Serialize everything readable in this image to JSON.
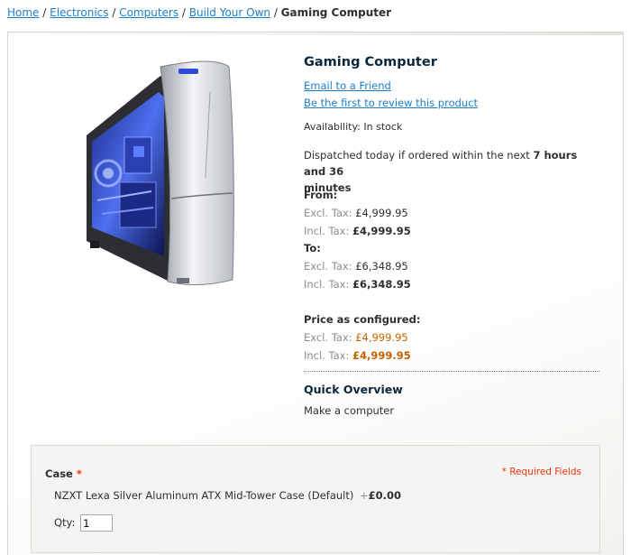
{
  "breadcrumb": {
    "items": [
      "Home",
      "Electronics",
      "Computers",
      "Build Your Own"
    ],
    "separator": " / ",
    "current": "Gaming Computer"
  },
  "product": {
    "name": "Gaming Computer",
    "email_link": "Email to a Friend",
    "review_link": "Be the first to review this product",
    "availability_label": "Availability:",
    "availability_value": "In stock",
    "dispatch_text": "Dispatched today if ordered within the next ",
    "dispatch_time_1": "7 hours and 36",
    "dispatch_time_2": "minutes",
    "from_label": "From:",
    "to_label": "To:",
    "excl_tax_label": "Excl. Tax:",
    "incl_tax_label": "Incl. Tax:",
    "from_excl": "£4,999.95",
    "from_incl": "£4,999.95",
    "to_excl": "£6,348.95",
    "to_incl": "£6,348.95",
    "configured_label": "Price as configured:",
    "configured_excl": "£4,999.95",
    "configured_incl": "£4,999.95",
    "overview_title": "Quick Overview",
    "overview_text": "Make a computer"
  },
  "options": {
    "label": "Case",
    "required_star": "*",
    "required_note": "* Required Fields",
    "item": "NZXT Lexa Silver Aluminum ATX Mid-Tower Case (Default)",
    "item_price_prefix": "+",
    "item_price": "£0.00",
    "qty_label": "Qty:",
    "qty_value": "1"
  },
  "colors": {
    "link": "#1e7ec8",
    "title": "#0a263c",
    "configured_price": "#c76200",
    "required": "#eb340a"
  }
}
